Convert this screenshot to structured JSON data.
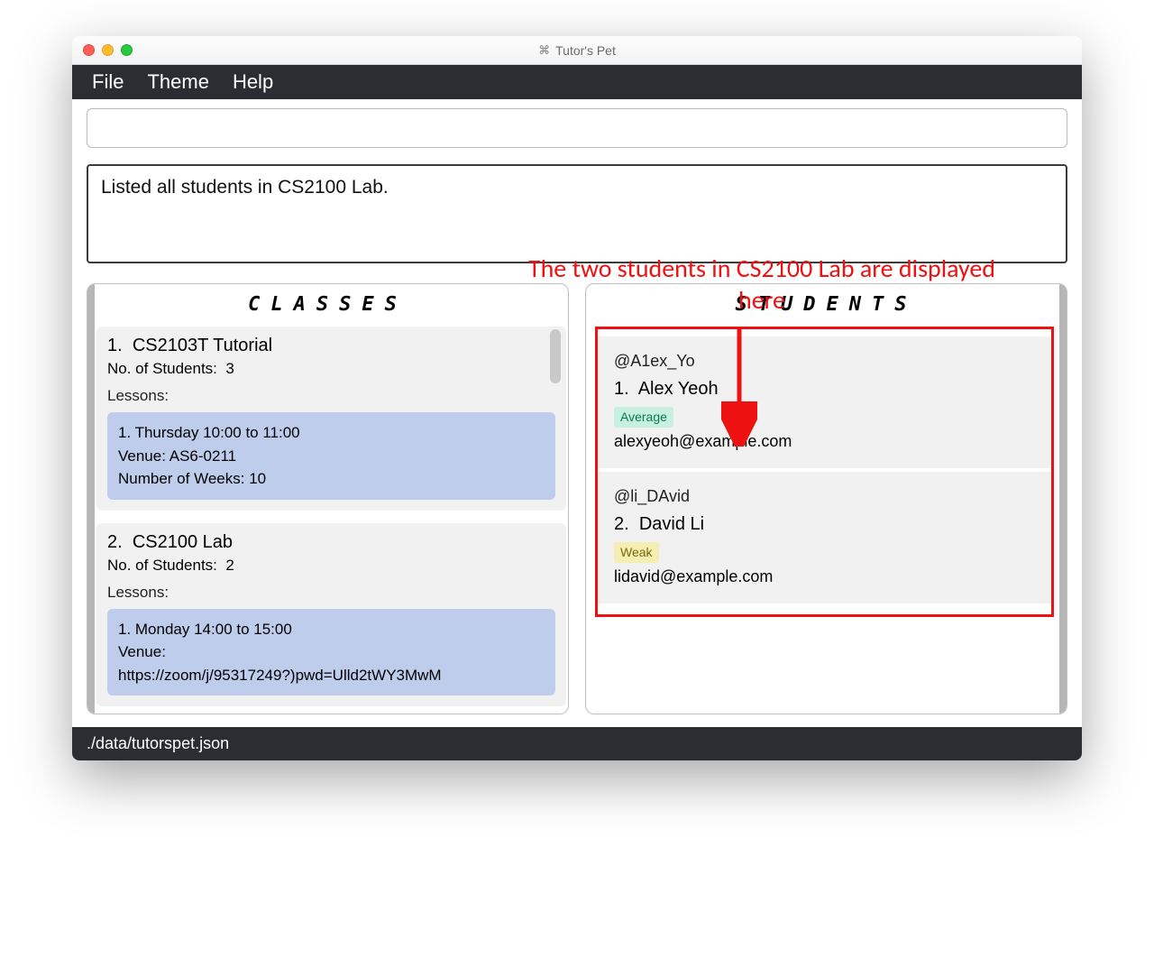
{
  "window_title": "Tutor's Pet",
  "menubar": {
    "file": "File",
    "theme": "Theme",
    "help": "Help"
  },
  "command_value": "",
  "result_message": "Listed all students in CS2100 Lab.",
  "annotation_text": "The two students in CS2100 Lab are displayed here",
  "panels": {
    "classes_header": "CLASSES",
    "students_header": "STUDENTS"
  },
  "classes": [
    {
      "index": "1.",
      "name": "CS2103T Tutorial",
      "students_label": "No. of Students:",
      "students_count": "3",
      "lessons_label": "Lessons:",
      "lesson": {
        "time": "1. Thursday 10:00 to 11:00",
        "venue_label": "Venue:",
        "venue": "AS6-0211",
        "weeks_label": "Number of Weeks:",
        "weeks": "10"
      }
    },
    {
      "index": "2.",
      "name": "CS2100 Lab",
      "students_label": "No. of Students:",
      "students_count": "2",
      "lessons_label": "Lessons:",
      "lesson": {
        "time": "1. Monday 14:00 to 15:00",
        "venue_label": "Venue:",
        "venue": "https://zoom/j/95317249?)pwd=Ulld2tWY3MwM"
      }
    }
  ],
  "students": [
    {
      "handle": "@A1ex_Yo",
      "index": "1.",
      "name": "Alex Yeoh",
      "badge": "Average",
      "badge_class": "badge-average",
      "email": "alexyeoh@example.com"
    },
    {
      "handle": "@li_DAvid",
      "index": "2.",
      "name": "David Li",
      "badge": "Weak",
      "badge_class": "badge-weak",
      "email": "lidavid@example.com"
    }
  ],
  "status_path": "./data/tutorspet.json"
}
